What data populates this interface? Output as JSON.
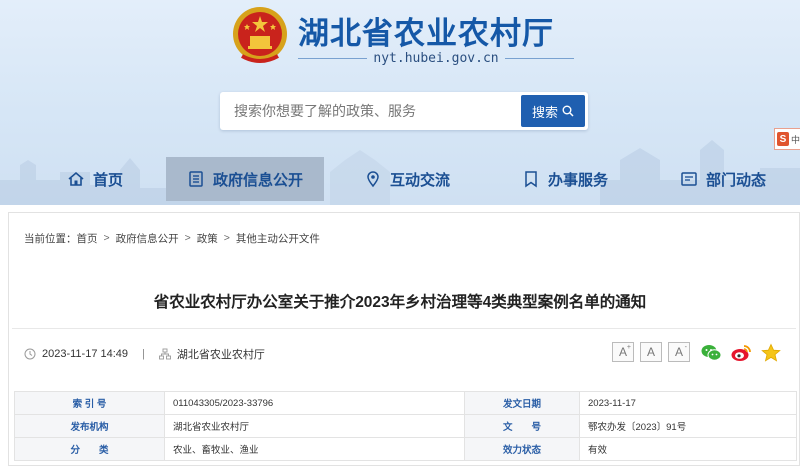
{
  "header": {
    "site_title": "湖北省农业农村厅",
    "site_domain": "nyt.hubei.gov.cn",
    "emblem_icon": "national-emblem-icon"
  },
  "search": {
    "placeholder": "搜索你想要了解的政策、服务",
    "button_label": "搜索"
  },
  "corner_badge": {
    "glyph": "S",
    "text": "中"
  },
  "nav": {
    "items": [
      {
        "label": "首页",
        "icon": "home-icon",
        "active": false
      },
      {
        "label": "政府信息公开",
        "icon": "document-list-icon",
        "active": true
      },
      {
        "label": "互动交流",
        "icon": "location-pin-icon",
        "active": false
      },
      {
        "label": "办事服务",
        "icon": "bookmark-icon",
        "active": false
      },
      {
        "label": "部门动态",
        "icon": "news-icon",
        "active": false
      }
    ]
  },
  "breadcrumb": {
    "prefix": "当前位置：",
    "items": [
      "首页",
      "政府信息公开",
      "政策",
      "其他主动公开文件"
    ]
  },
  "article": {
    "title": "省农业农村厅办公室关于推介2023年乡村治理等4类典型案例名单的通知",
    "date": "2023-11-17 14:49",
    "source": "湖北省农业农村厅"
  },
  "font_buttons": [
    {
      "label": "A",
      "mark": "+"
    },
    {
      "label": "A",
      "mark": ""
    },
    {
      "label": "A",
      "mark": "-"
    }
  ],
  "share": [
    "wechat-icon",
    "weibo-icon",
    "favorite-star-icon"
  ],
  "info_table": {
    "rows": [
      {
        "l1": "索 引 号",
        "v1": "011043305/2023-33796",
        "l2": "发文日期",
        "v2": "2023-11-17"
      },
      {
        "l1": "发布机构",
        "v1": "湖北省农业农村厅",
        "l2": "文　　号",
        "v2": "鄂农办发〔2023〕91号"
      },
      {
        "l1": "分　　类",
        "v1": "农业、畜牧业、渔业",
        "l2": "效力状态",
        "v2": "有效"
      }
    ]
  },
  "colors": {
    "brand_blue": "#1558a7",
    "nav_active_bg": "#a9b9cc",
    "search_button": "#1f5fb0",
    "label_blue": "#2a5ea6"
  }
}
